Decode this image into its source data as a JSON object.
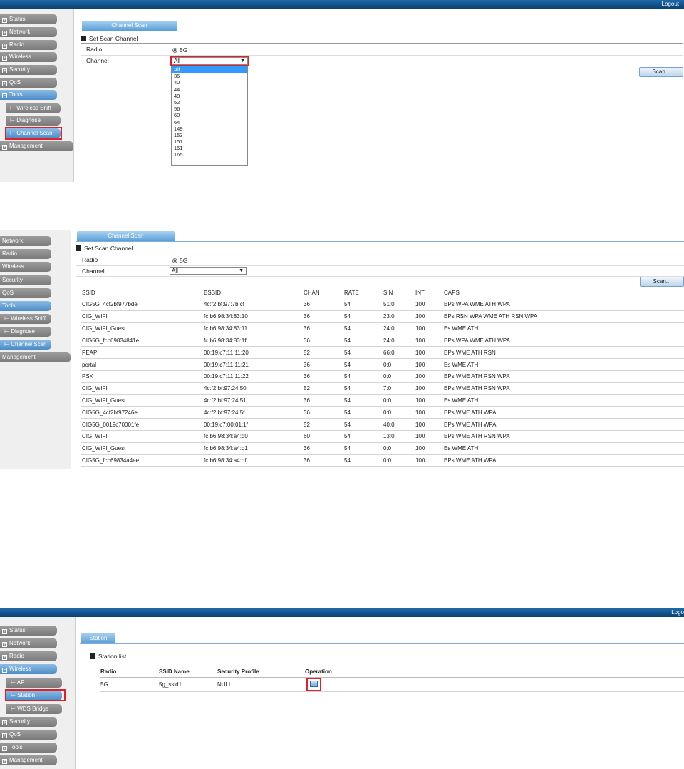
{
  "panel1": {
    "logout": "Logout",
    "nav": [
      {
        "label": "Status"
      },
      {
        "label": "Network"
      },
      {
        "label": "Radio"
      },
      {
        "label": "Wireless"
      },
      {
        "label": "Security"
      },
      {
        "label": "QoS"
      },
      {
        "label": "Tools"
      },
      {
        "label": "Wireless Sniff"
      },
      {
        "label": "Diagnose"
      },
      {
        "label": "Channel Scan"
      },
      {
        "label": "Management"
      }
    ],
    "tab": "Channel Scan",
    "section": "Set Scan Channel",
    "radio_label": "Radio",
    "radio_value": "5G",
    "channel_label": "Channel",
    "channel_value": "All",
    "scan_button": "Scan...",
    "dropdown": [
      "All",
      "36",
      "40",
      "44",
      "48",
      "52",
      "56",
      "60",
      "64",
      "149",
      "153",
      "157",
      "161",
      "165"
    ]
  },
  "panel2": {
    "nav": [
      {
        "label": "Network"
      },
      {
        "label": "Radio"
      },
      {
        "label": "Wireless"
      },
      {
        "label": "Security"
      },
      {
        "label": "QoS"
      },
      {
        "label": "Tools"
      },
      {
        "label": "Wireless Sniff"
      },
      {
        "label": "Diagnose"
      },
      {
        "label": "Channel Scan"
      },
      {
        "label": "Management"
      }
    ],
    "tab": "Channel Scan",
    "section": "Set Scan Channel",
    "radio_label": "Radio",
    "radio_value": "5G",
    "channel_label": "Channel",
    "channel_value": "All",
    "scan_button": "Scan...",
    "headers": [
      "SSID",
      "BSSID",
      "CHAN",
      "RATE",
      "S:N",
      "INT",
      "CAPS"
    ],
    "rows": [
      [
        "CIG5G_4cf2bf977bde",
        "4c:f2:bf:97:7b:cf",
        "36",
        "54",
        "51:0",
        "100",
        "EPs WPA WME ATH WPA"
      ],
      [
        "CIG_WIFI",
        "fc:b6:98:34:83:10",
        "36",
        "54",
        "23:0",
        "100",
        "EPs RSN WPA WME ATH RSN WPA"
      ],
      [
        "CIG_WIFI_Guest",
        "fc:b6:98:34:83:11",
        "36",
        "54",
        "24:0",
        "100",
        "Es WME ATH"
      ],
      [
        "CIG5G_fcb69834841e",
        "fc:b6:98:34:83:1f",
        "36",
        "54",
        "24:0",
        "100",
        "EPs WPA WME ATH WPA"
      ],
      [
        "PEAP",
        "00:19:c7:11:11:20",
        "52",
        "54",
        "66:0",
        "100",
        "EPs WME ATH RSN"
      ],
      [
        "portal",
        "00:19:c7:11:11:21",
        "36",
        "54",
        "0:0",
        "100",
        "Es WME ATH"
      ],
      [
        "PSK",
        "00:19:c7:11:11:22",
        "36",
        "54",
        "0:0",
        "100",
        "EPs WME ATH RSN WPA"
      ],
      [
        "CIG_WIFI",
        "4c:f2:bf:97:24:50",
        "52",
        "54",
        "7:0",
        "100",
        "EPs WME ATH RSN WPA"
      ],
      [
        "CIG_WIFI_Guest",
        "4c:f2:bf:97:24:51",
        "36",
        "54",
        "0:0",
        "100",
        "Es WME ATH"
      ],
      [
        "CIG5G_4cf2bf97246e",
        "4c:f2:bf:97:24:5f",
        "36",
        "54",
        "0:0",
        "100",
        "EPs WME ATH WPA"
      ],
      [
        "CIG5G_0019c70001fe",
        "00:19:c7:00:01:1f",
        "52",
        "54",
        "40:0",
        "100",
        "EPs WME ATH WPA"
      ],
      [
        "CIG_WIFI",
        "fc:b6:98:34:a4:d0",
        "60",
        "54",
        "13:0",
        "100",
        "EPs WME ATH RSN WPA"
      ],
      [
        "CIG_WIFI_Guest",
        "fc:b6:98:34:a4:d1",
        "36",
        "54",
        "0:0",
        "100",
        "Es WME ATH"
      ],
      [
        "CIG5G_fcb69834a4ee",
        "fc:b6:98:34:a4:df",
        "36",
        "54",
        "0:0",
        "100",
        "EPs WME ATH WPA"
      ]
    ]
  },
  "panel3": {
    "logout": "Logo",
    "nav": [
      {
        "label": "Status"
      },
      {
        "label": "Network"
      },
      {
        "label": "Radio"
      },
      {
        "label": "Wireless"
      },
      {
        "label": "AP"
      },
      {
        "label": "Station"
      },
      {
        "label": "WDS Bridge"
      },
      {
        "label": "Security"
      },
      {
        "label": "QoS"
      },
      {
        "label": "Tools"
      },
      {
        "label": "Management"
      }
    ],
    "tab": "Station",
    "section": "Station list",
    "headers": [
      "Radio",
      "SSID Name",
      "Security Profile",
      "Operation"
    ],
    "row": [
      "5G",
      "5g_ssid1",
      "NULL"
    ]
  },
  "colors": {
    "accent": "#4b8cc7",
    "highlight": "#e3202a",
    "header": "#0b3f74"
  },
  "icons": {
    "expand": "plus-box-icon",
    "collapse": "minus-box-icon",
    "edit": "edit-icon"
  }
}
